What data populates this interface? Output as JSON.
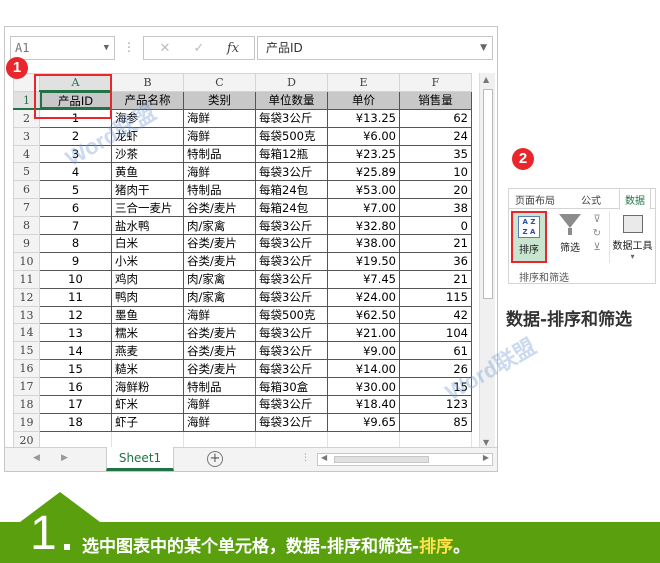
{
  "formula_bar": {
    "name_box": "A1",
    "cancel_icon": "✕",
    "enter_icon": "✓",
    "fx_label": "fx",
    "formula_value": "产品ID"
  },
  "columns": [
    "A",
    "B",
    "C",
    "D",
    "E",
    "F"
  ],
  "header_row": [
    "产品ID",
    "产品名称",
    "类别",
    "单位数量",
    "单价",
    "销售量"
  ],
  "rows": [
    [
      "1",
      "海参",
      "海鲜",
      "每袋3公斤",
      "¥13.25",
      "62"
    ],
    [
      "2",
      "龙虾",
      "海鲜",
      "每袋500克",
      "¥6.00",
      "24"
    ],
    [
      "3",
      "沙茶",
      "特制品",
      "每箱12瓶",
      "¥23.25",
      "35"
    ],
    [
      "4",
      "黄鱼",
      "海鲜",
      "每袋3公斤",
      "¥25.89",
      "10"
    ],
    [
      "5",
      "猪肉干",
      "特制品",
      "每箱24包",
      "¥53.00",
      "20"
    ],
    [
      "6",
      "三合一麦片",
      "谷类/麦片",
      "每箱24包",
      "¥7.00",
      "38"
    ],
    [
      "7",
      "盐水鸭",
      "肉/家禽",
      "每袋3公斤",
      "¥32.80",
      "0"
    ],
    [
      "8",
      "白米",
      "谷类/麦片",
      "每袋3公斤",
      "¥38.00",
      "21"
    ],
    [
      "9",
      "小米",
      "谷类/麦片",
      "每袋3公斤",
      "¥19.50",
      "36"
    ],
    [
      "10",
      "鸡肉",
      "肉/家禽",
      "每袋3公斤",
      "¥7.45",
      "21"
    ],
    [
      "11",
      "鸭肉",
      "肉/家禽",
      "每袋3公斤",
      "¥24.00",
      "115"
    ],
    [
      "12",
      "墨鱼",
      "海鲜",
      "每袋500克",
      "¥62.50",
      "42"
    ],
    [
      "13",
      "糯米",
      "谷类/麦片",
      "每袋3公斤",
      "¥21.00",
      "104"
    ],
    [
      "14",
      "燕麦",
      "谷类/麦片",
      "每袋3公斤",
      "¥9.00",
      "61"
    ],
    [
      "15",
      "糙米",
      "谷类/麦片",
      "每袋3公斤",
      "¥14.00",
      "26"
    ],
    [
      "16",
      "海鲜粉",
      "特制品",
      "每箱30盒",
      "¥30.00",
      "15"
    ],
    [
      "17",
      "虾米",
      "海鲜",
      "每袋3公斤",
      "¥18.40",
      "123"
    ],
    [
      "18",
      "虾子",
      "海鲜",
      "每袋3公斤",
      "¥9.65",
      "85"
    ]
  ],
  "row_numbers": [
    "1",
    "2",
    "3",
    "4",
    "5",
    "6",
    "7",
    "8",
    "9",
    "10",
    "11",
    "12",
    "13",
    "14",
    "15",
    "16",
    "17",
    "18",
    "19",
    "20"
  ],
  "sheet_tab": "Sheet1",
  "add_sheet": "+",
  "badges": {
    "one": "1",
    "two": "2"
  },
  "ribbon": {
    "tabs": [
      "页面布局",
      "公式",
      "数据"
    ],
    "sort_label": "排序",
    "sort_icon_text": "A Z\nZ A",
    "filter_label": "筛选",
    "data_tools_label": "数据工具",
    "group_label": "排序和筛选"
  },
  "ribbon_caption": "数据-排序和筛选",
  "watermark": "Word联盟",
  "banner": {
    "step_number": "1",
    "text_main": "选中图表中的某个单元格，数据-排序和筛选-",
    "text_highlight": "排序",
    "text_end": "。"
  },
  "colors": {
    "accent_green": "#217346",
    "banner_green": "#5aa00e",
    "highlight_red": "#e8262b",
    "highlight_yellow": "#ffe14b"
  }
}
